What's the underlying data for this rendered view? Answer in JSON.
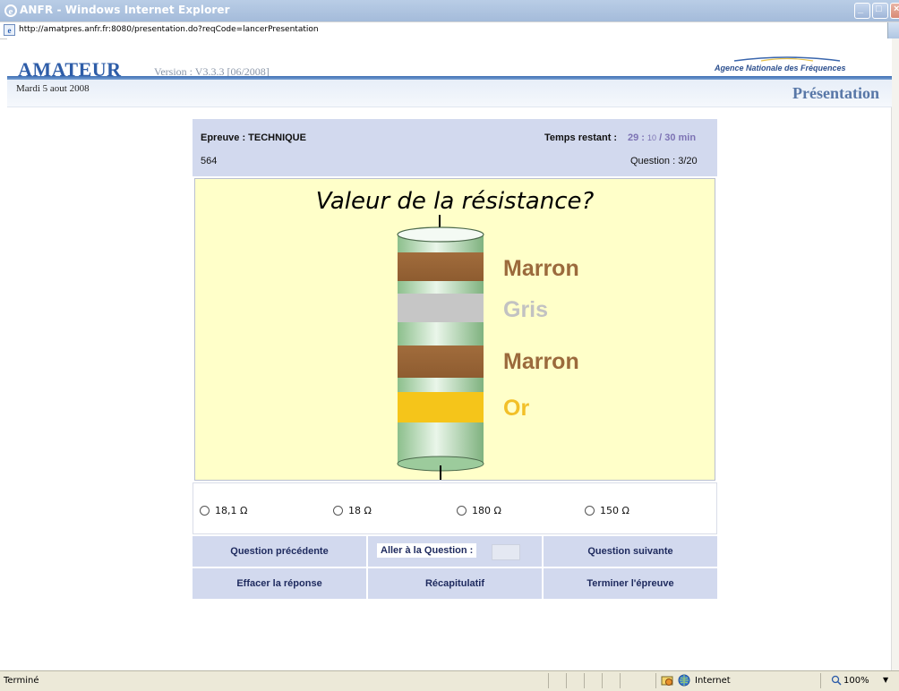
{
  "window": {
    "title": "ANFR - Windows Internet Explorer",
    "url": "http://amatpres.anfr.fr:8080/presentation.do?reqCode=lancerPresentation"
  },
  "header": {
    "brand": "AMATEUR",
    "version": "Version : V3.3.3 [06/2008]",
    "agency": "Agence Nationale des Fréquences",
    "date": "Mardi 5 aout 2008",
    "section": "Présentation"
  },
  "exam": {
    "epreuve": "Epreuve : TECHNIQUE",
    "code": "564",
    "timer_label": "Temps restant :",
    "timer_minutes": "29 :",
    "timer_seconds": "10",
    "timer_total": "/ 30 min",
    "question_counter": "Question : 3/20"
  },
  "question": {
    "title": "Valeur de la résistance?",
    "bands": [
      {
        "label": "Marron",
        "color": "#9b6a3c"
      },
      {
        "label": "Gris",
        "color": "#c7c7c7"
      },
      {
        "label": "Marron",
        "color": "#9b6a3c"
      },
      {
        "label": "Or",
        "color": "#f4c418"
      }
    ]
  },
  "answers": [
    {
      "label": "18,1 Ω"
    },
    {
      "label": "18 Ω"
    },
    {
      "label": "180 Ω"
    },
    {
      "label": "150 Ω"
    }
  ],
  "nav": {
    "prev": "Question précédente",
    "goto": "Aller à la Question :",
    "next": "Question suivante",
    "clear": "Effacer la réponse",
    "summary": "Récapitulatif",
    "finish": "Terminer l'épreuve"
  },
  "status": {
    "text": "Terminé",
    "zone": "Internet",
    "zoom": "100%"
  },
  "colors": {
    "infobar": "#d2d9ee",
    "question_bg": "#ffffc9",
    "brand_blue": "#2e5da8"
  }
}
